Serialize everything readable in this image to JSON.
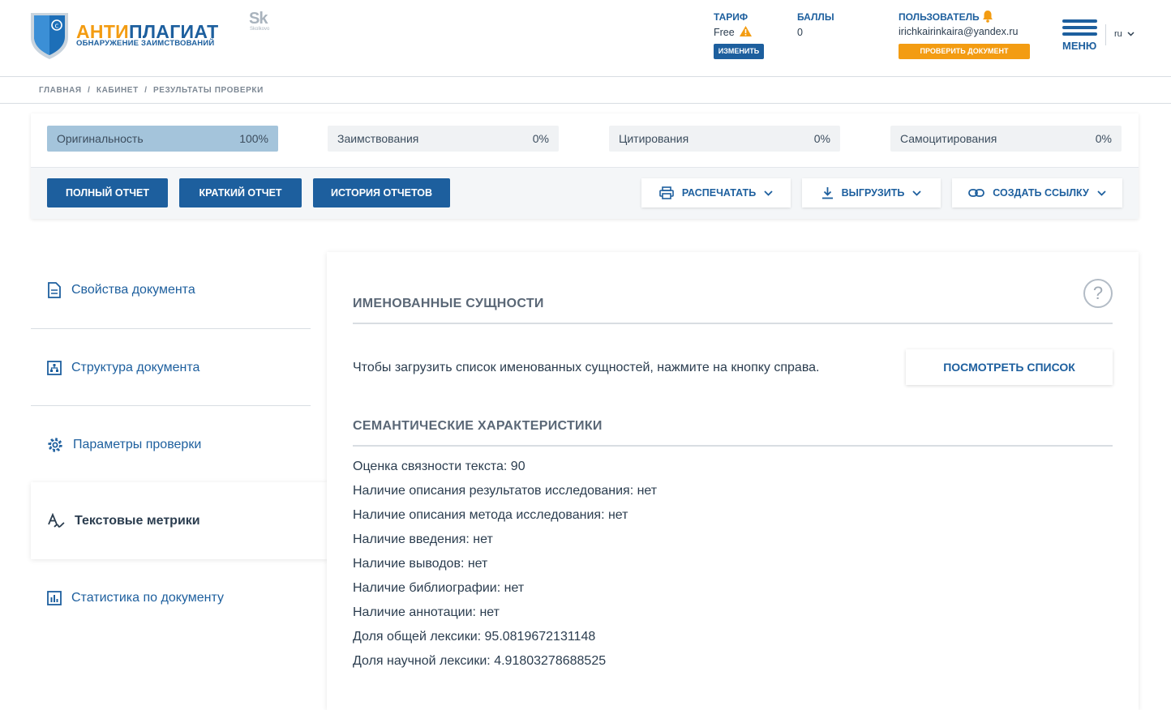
{
  "header": {
    "logo_title_a": "АНТИ",
    "logo_title_b": "ПЛАГИАТ",
    "logo_subtitle": "ОБНАРУЖЕНИЕ ЗАИМСТВОВАНИЙ",
    "skolkovo_mark": "Sk",
    "skolkovo_text": "Skolkovo",
    "tariff_label": "ТАРИФ",
    "tariff_value": "Free",
    "change_button": "ИЗМЕНИТЬ",
    "points_label": "БАЛЛЫ",
    "points_value": "0",
    "user_label": "ПОЛЬЗОВАТЕЛЬ",
    "user_email": "irichkairinkaira@yandex.ru",
    "check_button": "ПРОВЕРИТЬ ДОКУМЕНТ",
    "menu_label": "МЕНЮ",
    "language": "ru"
  },
  "breadcrumb": [
    "ГЛАВНАЯ",
    "/",
    "КАБИНЕТ",
    "/",
    "РЕЗУЛЬТАТЫ ПРОВЕРКИ"
  ],
  "metrics": [
    {
      "label": "Оригинальность",
      "value": "100%"
    },
    {
      "label": "Заимствования",
      "value": "0%"
    },
    {
      "label": "Цитирования",
      "value": "0%"
    },
    {
      "label": "Самоцитирования",
      "value": "0%"
    }
  ],
  "actions": {
    "full_report": "ПОЛНЫЙ ОТЧЕТ",
    "short_report": "КРАТКИЙ ОТЧЕТ",
    "history": "ИСТОРИЯ ОТЧЕТОВ",
    "print": "РАСПЕЧАТАТЬ",
    "export": "ВЫГРУЗИТЬ",
    "create_link": "СОЗДАТЬ ССЫЛКУ"
  },
  "sidebar": {
    "items": [
      {
        "label": "Свойства документа",
        "icon": "document-icon"
      },
      {
        "label": "Структура документа",
        "icon": "structure-icon"
      },
      {
        "label": "Параметры проверки",
        "icon": "gear-icon"
      },
      {
        "label": "Текстовые метрики",
        "icon": "text-metrics-icon"
      },
      {
        "label": "Статистика по документу",
        "icon": "chart-icon"
      }
    ],
    "active_index": 3
  },
  "main": {
    "help_symbol": "?",
    "named_entities_title": "ИМЕНОВАННЫЕ СУЩНОСТИ",
    "named_entities_text": "Чтобы загрузить список именованных сущностей, нажмите на кнопку справа.",
    "view_list_button": "ПОСМОТРЕТЬ СПИСОК",
    "semantic_title": "СЕМАНТИЧЕСКИЕ ХАРАКТЕРИСТИКИ",
    "semantic_items": [
      "Оценка связности текста: 90",
      "Наличие описания результатов исследования: нет",
      "Наличие описания метода исследования: нет",
      "Наличие введения: нет",
      "Наличие выводов: нет",
      "Наличие библиографии: нет",
      "Наличие аннотации: нет",
      "Доля общей лексики: 95.0819672131148",
      "Доля научной лексики: 4.91803278688525"
    ]
  },
  "colors": {
    "brand_blue": "#1d5f9e",
    "brand_orange": "#f39c12",
    "active_metric": "#a4c4db"
  }
}
